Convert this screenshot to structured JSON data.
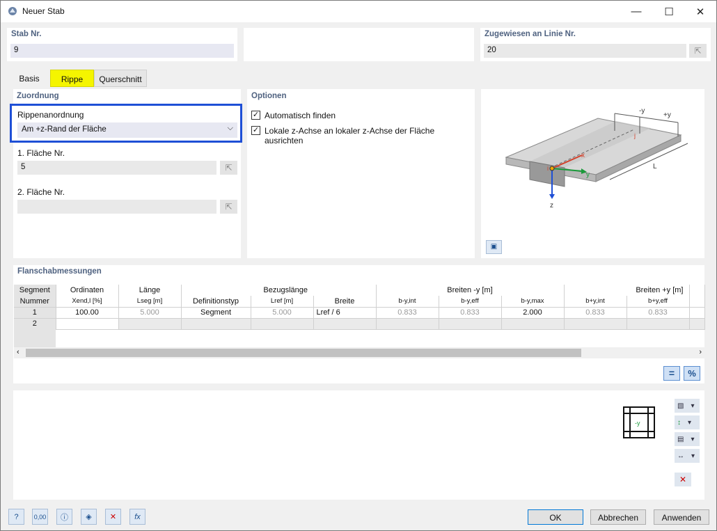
{
  "window": {
    "title": "Neuer Stab",
    "minimize": "—",
    "maximize": "☐",
    "close": "✕"
  },
  "stab": {
    "label": "Stab Nr.",
    "value": "9"
  },
  "zugewiesen": {
    "label": "Zugewiesen an Linie Nr.",
    "value": "20"
  },
  "tabs": [
    "Basis",
    "Rippe",
    "Querschnitt"
  ],
  "zuordnung": {
    "title": "Zuordnung",
    "rippen_label": "Rippenanordnung",
    "rippen_value": "Am +z-Rand der Fläche",
    "flaeche1_label": "1. Fläche Nr.",
    "flaeche1_value": "5",
    "flaeche2_label": "2. Fläche Nr.",
    "flaeche2_value": ""
  },
  "optionen": {
    "title": "Optionen",
    "auto_label": "Automatisch finden",
    "auto_checked": true,
    "lokal_label": "Lokale z-Achse an lokaler z-Achse der Fläche ausrichten",
    "lokal_checked": true
  },
  "diagram": {
    "minus_y": "-y",
    "plus_y": "+y",
    "L": "L",
    "x": "x",
    "y": "y",
    "z": "z",
    "i": "i",
    "j": "j"
  },
  "flansch": {
    "title": "Flanschabmessungen",
    "headers": {
      "segment": "Segment",
      "nummer": "Nummer",
      "ordinaten": "Ordinaten",
      "xend": "Xend,l [%]",
      "laenge": "Länge",
      "lseg": "Lseg [m]",
      "definitionstyp": "Definitionstyp",
      "bezugslaenge": "Bezugslänge",
      "lref": "Lref [m]",
      "breite": "Breite",
      "breiten_minus": "Breiten -y [m]",
      "b_minus_int": "b-y,int",
      "b_minus_eff": "b-y,eff",
      "b_minus_max": "b-y,max",
      "breiten_plus": "Breiten +y [m]",
      "b_plus_int": "b+y,int",
      "b_plus_eff": "b+y,eff"
    },
    "rows": [
      {
        "nr": "1",
        "ordinate": "100.00",
        "lseg": "5.000",
        "deftyp": "Segment",
        "lref": "5.000",
        "breite": "Lref / 6",
        "bmi": "0.833",
        "bme": "0.833",
        "bmm": "2.000",
        "bpi": "0.833",
        "bpe": "0.833"
      },
      {
        "nr": "2",
        "ordinate": "",
        "lseg": "",
        "deftyp": "",
        "lref": "",
        "breite": "",
        "bmi": "",
        "bme": "",
        "bmm": "",
        "bpi": "",
        "bpe": ""
      }
    ]
  },
  "preview": {
    "section_label": "-y"
  },
  "buttons": {
    "ok": "OK",
    "abbrechen": "Abbrechen",
    "anwenden": "Anwenden"
  },
  "colors": {
    "tab_active": "#f5f500",
    "highlight_border": "#1e4fd6",
    "panel_title": "#4f6280"
  }
}
